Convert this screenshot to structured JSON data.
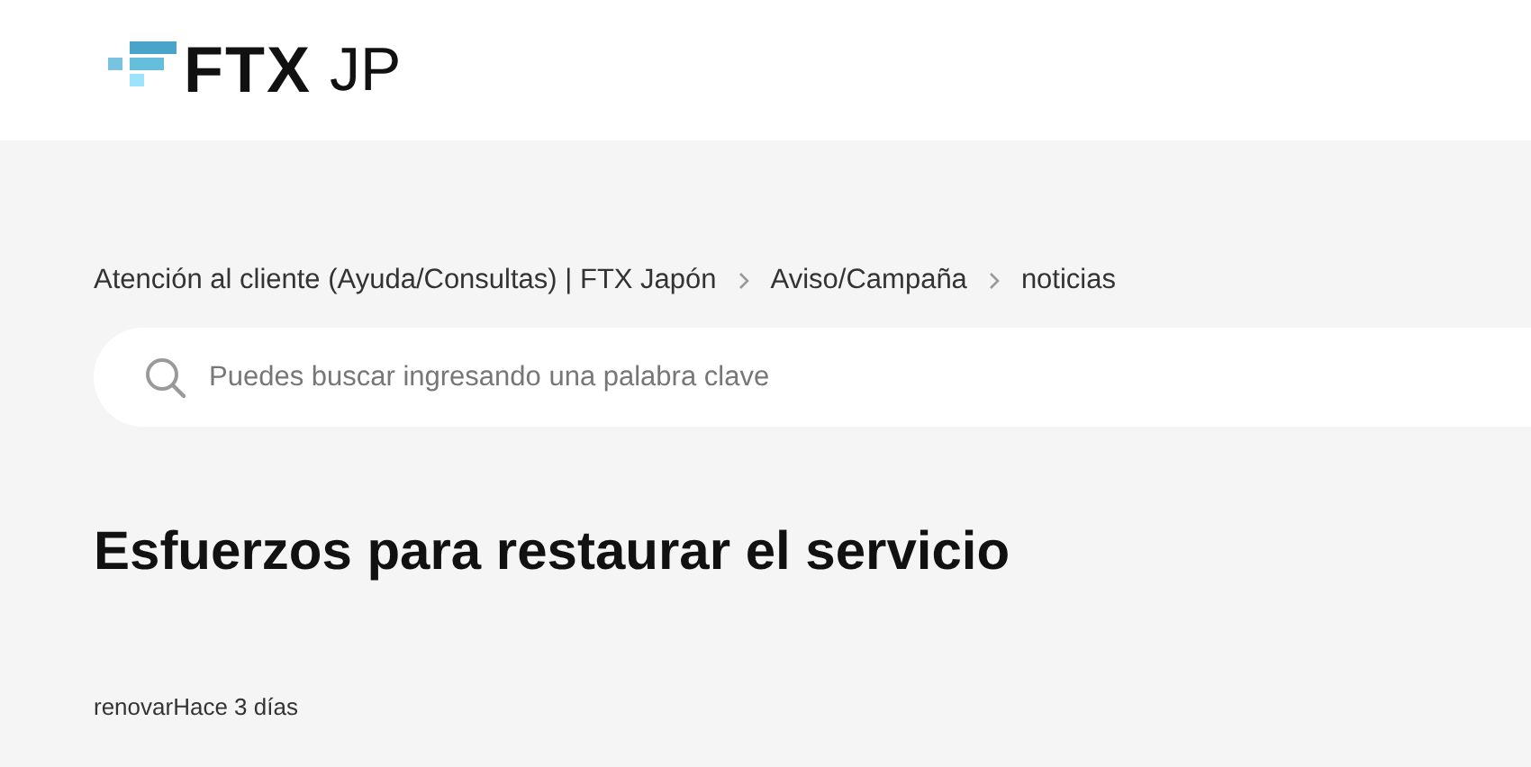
{
  "header": {
    "logo": {
      "brand": "FTX",
      "suffix": "JP"
    }
  },
  "breadcrumb": [
    {
      "label": "Atención al cliente (Ayuda/Consultas) | FTX Japón"
    },
    {
      "label": "Aviso/Campaña"
    },
    {
      "label": "noticias"
    }
  ],
  "search": {
    "placeholder": "Puedes buscar ingresando una palabra clave"
  },
  "article": {
    "title": "Esfuerzos para restaurar el servicio",
    "meta": "renovarHace 3 días"
  }
}
